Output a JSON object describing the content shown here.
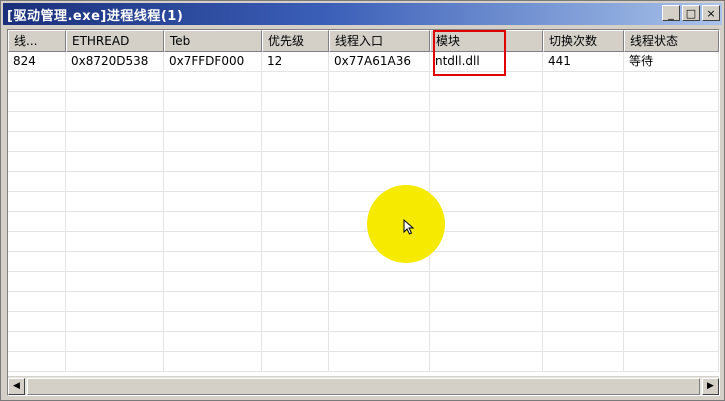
{
  "window": {
    "title": "[驱动管理.exe]进程线程(1)",
    "buttons": {
      "minimize": "_",
      "maximize": "□",
      "close": "×"
    }
  },
  "table": {
    "columns": [
      "线...",
      "ETHREAD",
      "Teb",
      "优先级",
      "线程入口",
      "模块",
      "切换次数",
      "线程状态"
    ],
    "rows": [
      [
        "824",
        "0x8720D538",
        "0x7FFDF000",
        "12",
        "0x77A61A36",
        "ntdll.dll",
        "441",
        "等待"
      ]
    ],
    "empty_row_count": 15
  },
  "highlight": {
    "column": "模块",
    "color": "#e00000"
  },
  "scrollbar": {
    "left_arrow": "◀",
    "right_arrow": "▶"
  },
  "colors": {
    "titlebar_start": "#1a2f7a",
    "titlebar_end": "#a9c3ea",
    "cursor_halo": "#f5ea00",
    "highlight_box": "#e00000"
  }
}
